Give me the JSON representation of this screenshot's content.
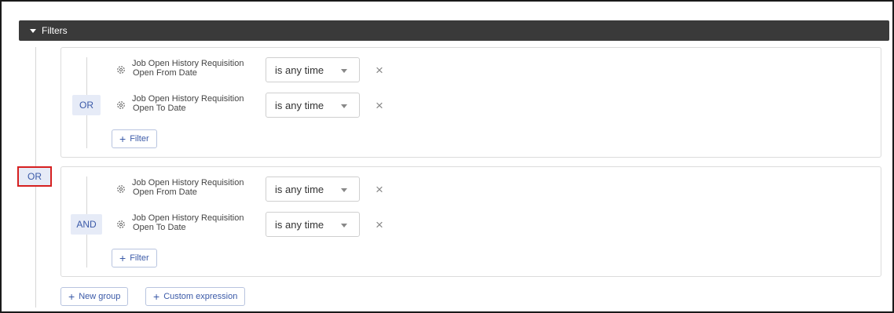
{
  "header": {
    "title": "Filters"
  },
  "outer_operator": "OR",
  "groups": [
    {
      "operator": "OR",
      "filters": [
        {
          "field_line1": "Job Open History Requisition",
          "field_line2": "Open From Date",
          "condition": "is any time"
        },
        {
          "field_line1": "Job Open History Requisition",
          "field_line2": "Open To Date",
          "condition": "is any time"
        }
      ],
      "add_filter_label": "Filter"
    },
    {
      "operator": "AND",
      "filters": [
        {
          "field_line1": "Job Open History Requisition",
          "field_line2": "Open From Date",
          "condition": "is any time"
        },
        {
          "field_line1": "Job Open History Requisition",
          "field_line2": "Open To Date",
          "condition": "is any time"
        }
      ],
      "add_filter_label": "Filter"
    }
  ],
  "footer": {
    "new_group_label": "New group",
    "custom_expression_label": "Custom expression"
  },
  "icons": {
    "gear": "gear-icon",
    "close": "close-icon",
    "plus": "plus-icon",
    "caret": "chevron-down-icon"
  },
  "colors": {
    "header_bg": "#3a3a3a",
    "accent": "#3b5aa8",
    "badge_bg": "#e6ebf7",
    "highlight": "#d62020"
  }
}
